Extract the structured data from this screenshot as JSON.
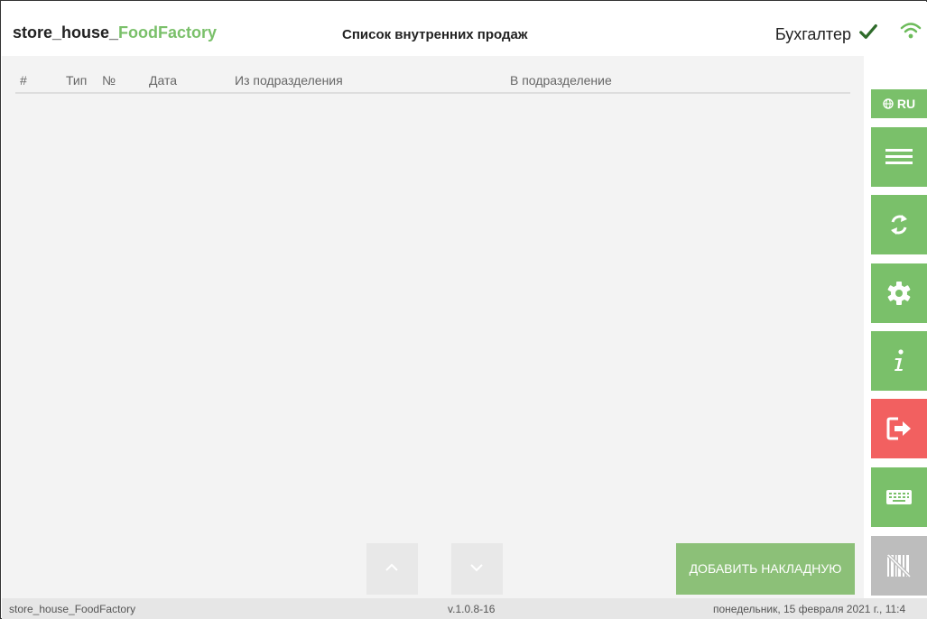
{
  "header": {
    "app_name_prefix": "store_house_",
    "app_name_accent": "FoodFactory",
    "page_title": "Список внутренних продаж",
    "role": "Бухгалтер"
  },
  "table": {
    "columns": [
      "#",
      "Тип",
      "№",
      "Дата",
      "Из подразделения",
      "В подразделение"
    ]
  },
  "actions": {
    "add_invoice_label": "ДОБАВИТЬ НАКЛАДНУЮ"
  },
  "sidebar": {
    "language_label": "RU"
  },
  "status": {
    "app": "store_house_FoodFactory",
    "version": "v.1.0.8-16",
    "datetime": "понедельник, 15 февраля 2021 г., 11:4"
  },
  "colors": {
    "accent_green": "#7ac06a",
    "exit_red": "#f26060",
    "disabled_gray": "#bdbdbd"
  },
  "icons": {
    "connected": "check-icon",
    "network": "wifi-icon",
    "language": "globe-icon",
    "menu": "hamburger-icon",
    "sync": "sync-icon",
    "settings": "gear-icon",
    "info": "info-icon",
    "exit": "exit-icon",
    "keyboard": "keyboard-icon",
    "barcode": "barcode-icon"
  }
}
